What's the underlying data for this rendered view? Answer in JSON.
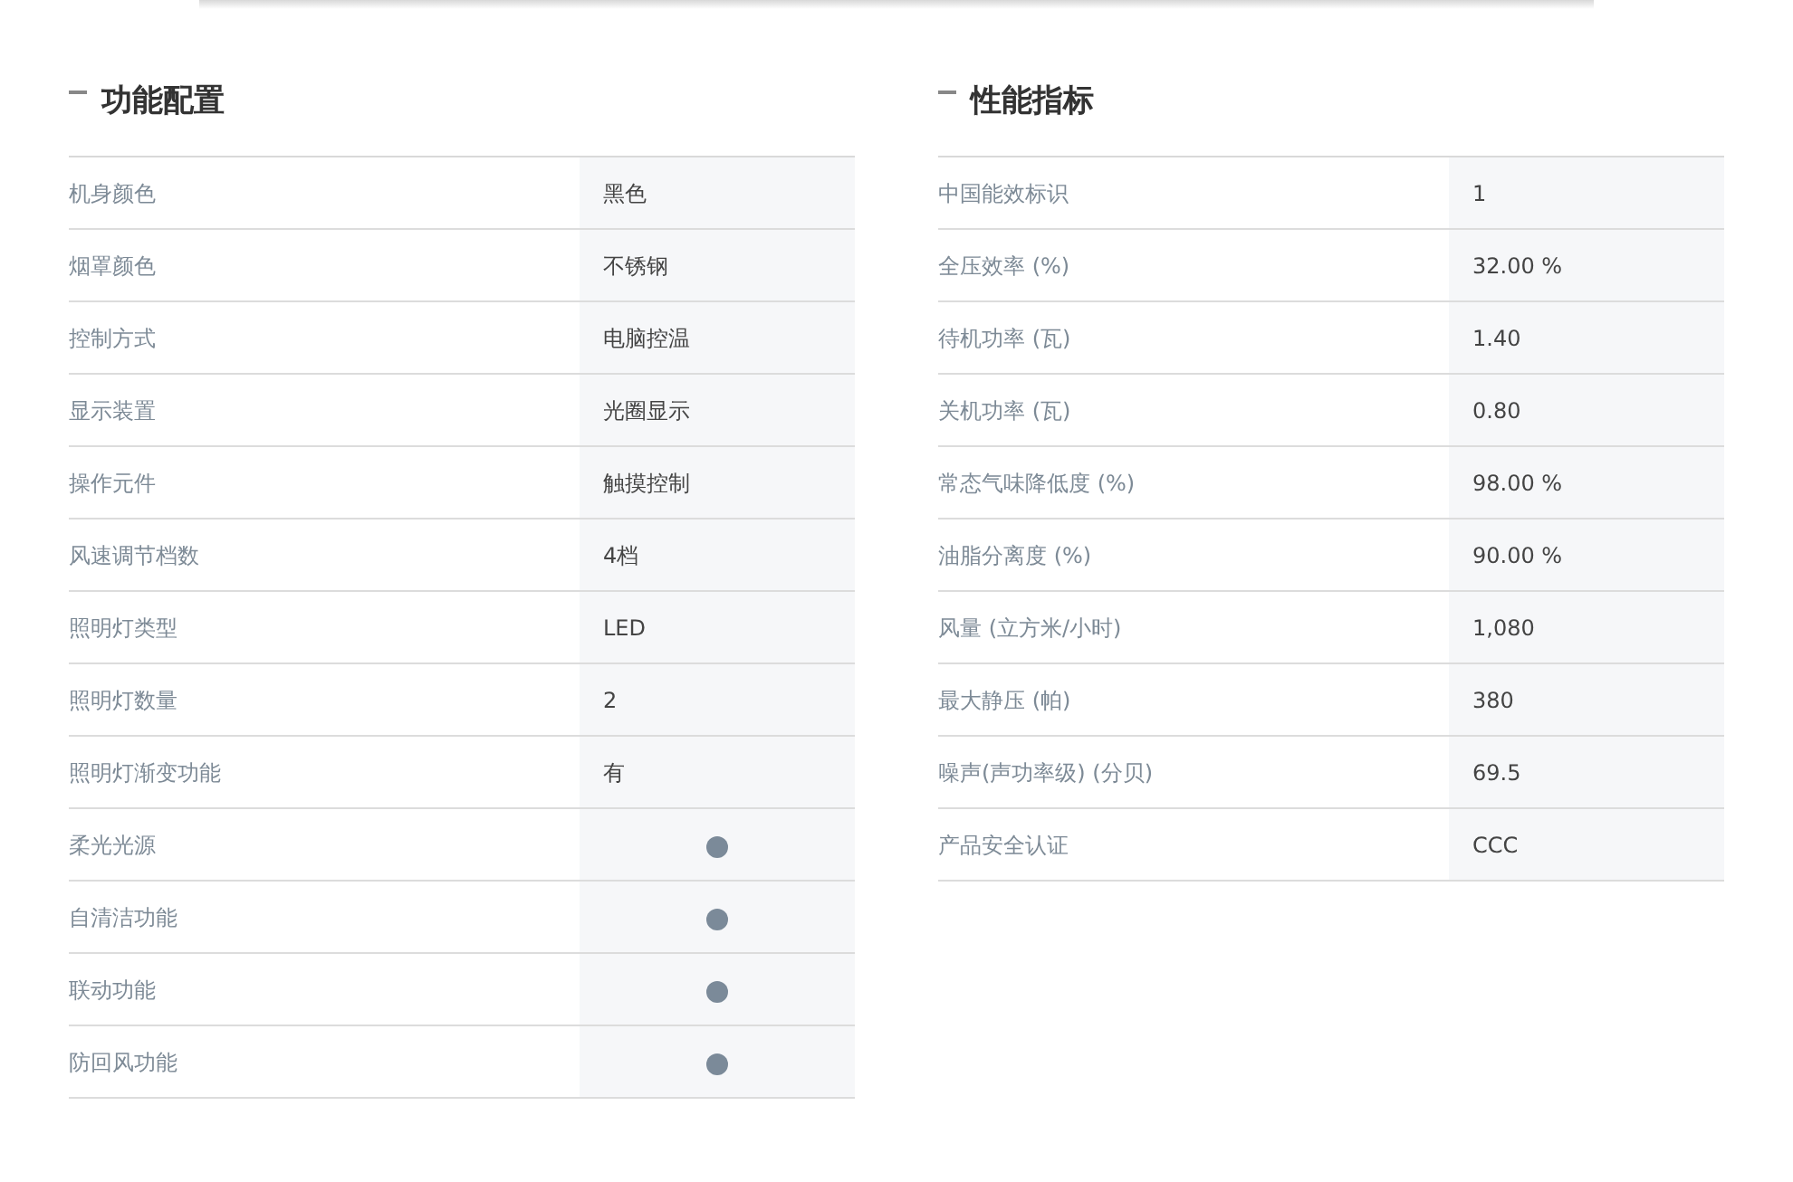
{
  "sections": [
    {
      "title": "功能配置",
      "rows": [
        {
          "label": "机身颜色",
          "kind": "text",
          "value": "黑色"
        },
        {
          "label": "烟罩颜色",
          "kind": "text",
          "value": "不锈钢"
        },
        {
          "label": "控制方式",
          "kind": "text",
          "value": "电脑控温"
        },
        {
          "label": "显示装置",
          "kind": "text",
          "value": "光圈显示"
        },
        {
          "label": "操作元件",
          "kind": "text",
          "value": "触摸控制"
        },
        {
          "label": "风速调节档数",
          "kind": "text",
          "value": "4档"
        },
        {
          "label": "照明灯类型",
          "kind": "text",
          "value": "LED"
        },
        {
          "label": "照明灯数量",
          "kind": "text",
          "value": "2"
        },
        {
          "label": "照明灯渐变功能",
          "kind": "text",
          "value": "有"
        },
        {
          "label": "柔光光源",
          "kind": "dot",
          "on": true
        },
        {
          "label": "自清洁功能",
          "kind": "dot",
          "on": true
        },
        {
          "label": "联动功能",
          "kind": "dot",
          "on": true
        },
        {
          "label": "防回风功能",
          "kind": "dot",
          "on": true
        }
      ]
    },
    {
      "title": "性能指标",
      "rows": [
        {
          "label": "中国能效标识",
          "kind": "text",
          "value": "1"
        },
        {
          "label": "全压效率 (%)",
          "kind": "text",
          "value": "32.00 %"
        },
        {
          "label": "待机功率 (瓦)",
          "kind": "text",
          "value": "1.40"
        },
        {
          "label": "关机功率 (瓦)",
          "kind": "text",
          "value": "0.80"
        },
        {
          "label": "常态气味降低度 (%)",
          "kind": "text",
          "value": "98.00 %"
        },
        {
          "label": "油脂分离度 (%)",
          "kind": "text",
          "value": "90.00 %"
        },
        {
          "label": "风量 (立方米/小时)",
          "kind": "text",
          "value": "1,080"
        },
        {
          "label": "最大静压 (帕)",
          "kind": "text",
          "value": "380"
        },
        {
          "label": "噪声(声功率级) (分贝)",
          "kind": "text",
          "value": "69.5"
        },
        {
          "label": "产品安全认证",
          "kind": "text",
          "value": "CCC"
        }
      ]
    }
  ]
}
